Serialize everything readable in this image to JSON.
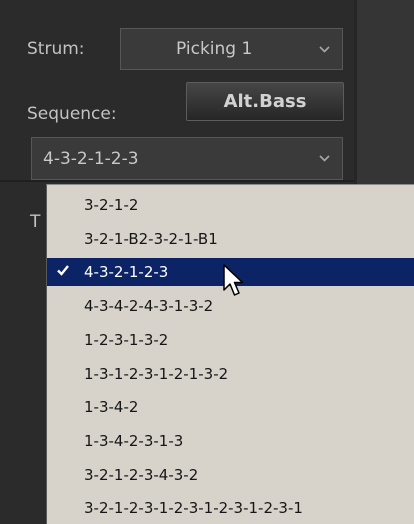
{
  "strum": {
    "label": "Strum:",
    "value": "Picking 1",
    "arrow_icon": "chevron-down-icon"
  },
  "sequence": {
    "label": "Sequence:",
    "button_label": "Alt.Bass",
    "value": "4-3-2-1-2-3",
    "arrow_icon": "chevron-down-icon"
  },
  "hidden_label_fragment": "T",
  "dropdown": {
    "selected_index": 2,
    "items": [
      {
        "label": "3-2-1-2"
      },
      {
        "label": "3-2-1-B2-3-2-1-B1"
      },
      {
        "label": "4-3-2-1-2-3"
      },
      {
        "label": "4-3-4-2-4-3-1-3-2"
      },
      {
        "label": "1-2-3-1-3-2"
      },
      {
        "label": "1-3-1-2-3-1-2-1-3-2"
      },
      {
        "label": "1-3-4-2"
      },
      {
        "label": "1-3-4-2-3-1-3"
      },
      {
        "label": "3-2-1-2-3-4-3-2"
      },
      {
        "label": "3-2-1-2-3-1-2-3-1-2-3-1-2-3-1"
      }
    ]
  },
  "colors": {
    "panel_background": "#2b2b2b",
    "dropdown_background": "#d7d3ca",
    "selection_highlight": "#0c2466"
  },
  "icons": {
    "check": "check-icon",
    "pointer": "mouse-pointer-icon"
  }
}
